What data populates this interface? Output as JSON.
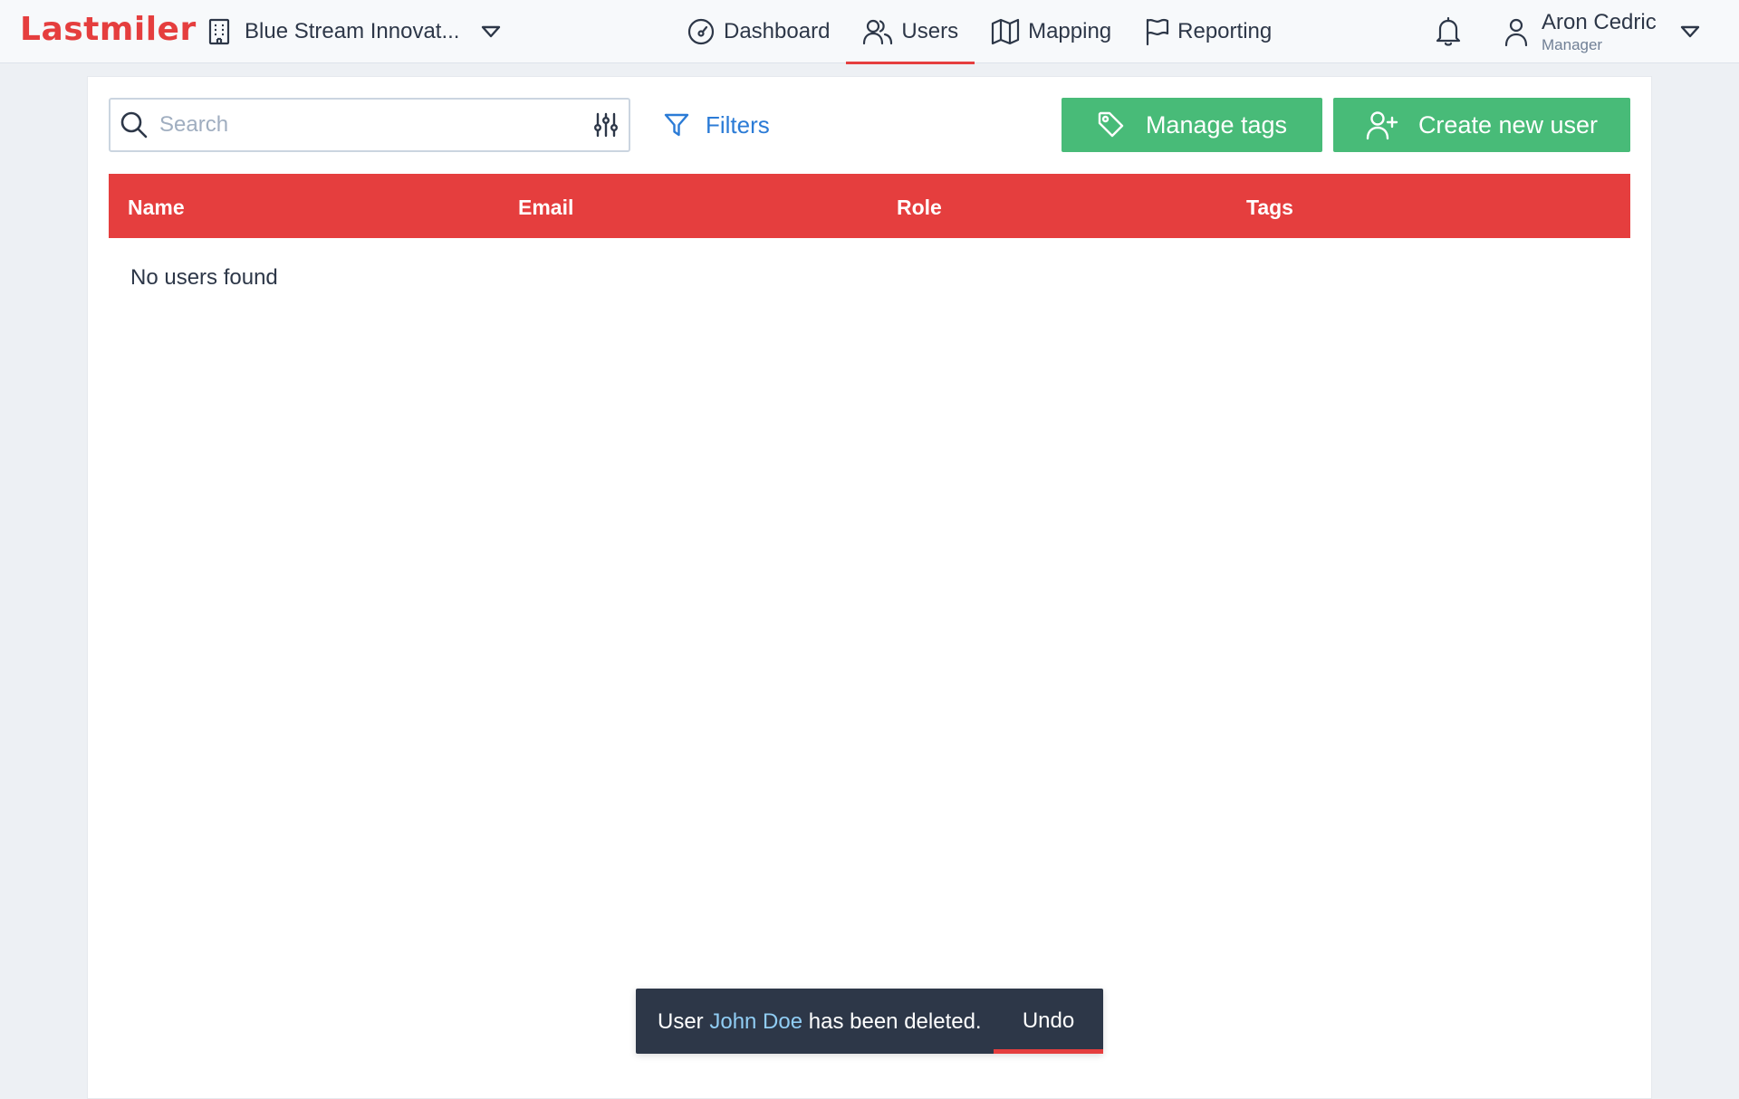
{
  "app": {
    "logo": "Lastmiler"
  },
  "org_selector": {
    "label": "Blue Stream Innovat..."
  },
  "nav": {
    "items": [
      {
        "label": "Dashboard",
        "icon": "gauge-icon"
      },
      {
        "label": "Users",
        "icon": "users-icon",
        "active": true
      },
      {
        "label": "Mapping",
        "icon": "map-icon"
      },
      {
        "label": "Reporting",
        "icon": "flag-icon"
      }
    ]
  },
  "user_menu": {
    "name": "Aron Cedric",
    "role": "Manager"
  },
  "toolbar": {
    "search_placeholder": "Search",
    "search_value": "",
    "filters_label": "Filters",
    "manage_tags_label": "Manage tags",
    "create_user_label": "Create new user"
  },
  "table": {
    "columns": [
      "Name",
      "Email",
      "Role",
      "Tags"
    ],
    "rows": [],
    "empty_message": "No users found"
  },
  "toast": {
    "prefix": "User",
    "user_name": "John Doe",
    "suffix": "has been deleted.",
    "action_label": "Undo"
  },
  "colors": {
    "brand_red": "#e53e3e",
    "action_green": "#48bb78",
    "link_blue": "#2b7bd6",
    "toast_bg": "#2d3748"
  }
}
